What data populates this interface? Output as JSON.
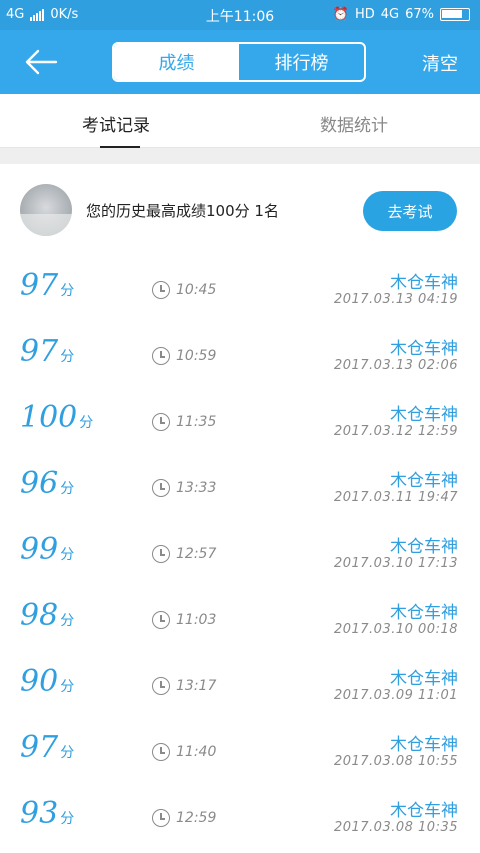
{
  "status_bar": {
    "network": "4G",
    "speed": "0K/s",
    "time": "上午11:06",
    "hd": "HD",
    "net2": "4G",
    "battery": "67%"
  },
  "app_bar": {
    "tabs": [
      {
        "label": "成绩",
        "active": true
      },
      {
        "label": "排行榜",
        "active": false
      }
    ],
    "clear_label": "清空"
  },
  "sub_tabs": [
    {
      "label": "考试记录",
      "active": true
    },
    {
      "label": "数据统计",
      "active": false
    }
  ],
  "summary": {
    "text": "您的历史最高成绩100分  1名",
    "button_label": "去考试"
  },
  "records": [
    {
      "score": "97",
      "unit": "分",
      "duration": "10:45",
      "name": "木仓车神",
      "date": "2017.03.13  04:19"
    },
    {
      "score": "97",
      "unit": "分",
      "duration": "10:59",
      "name": "木仓车神",
      "date": "2017.03.13  02:06"
    },
    {
      "score": "100",
      "unit": "分",
      "duration": "11:35",
      "name": "木仓车神",
      "date": "2017.03.12  12:59"
    },
    {
      "score": "96",
      "unit": "分",
      "duration": "13:33",
      "name": "木仓车神",
      "date": "2017.03.11  19:47"
    },
    {
      "score": "99",
      "unit": "分",
      "duration": "12:57",
      "name": "木仓车神",
      "date": "2017.03.10  17:13"
    },
    {
      "score": "98",
      "unit": "分",
      "duration": "11:03",
      "name": "木仓车神",
      "date": "2017.03.10  00:18"
    },
    {
      "score": "90",
      "unit": "分",
      "duration": "13:17",
      "name": "木仓车神",
      "date": "2017.03.09  11:01"
    },
    {
      "score": "97",
      "unit": "分",
      "duration": "11:40",
      "name": "木仓车神",
      "date": "2017.03.08  10:55"
    },
    {
      "score": "93",
      "unit": "分",
      "duration": "12:59",
      "name": "木仓车神",
      "date": "2017.03.08  10:35"
    }
  ],
  "colors": {
    "primary": "#34a8ea",
    "score_blue": "#2f9fe0",
    "gray_text": "#8a8a8a"
  }
}
